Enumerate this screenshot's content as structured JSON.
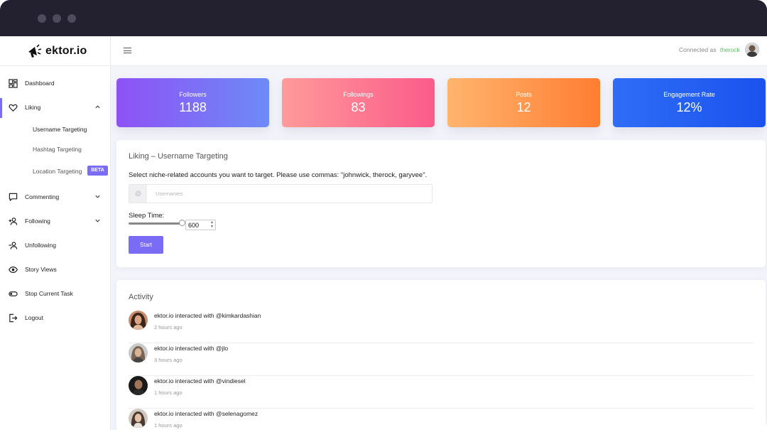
{
  "brand": {
    "name": "ektor.io"
  },
  "topbar": {
    "connected_label": "Connected as",
    "username": "therock"
  },
  "sidebar": {
    "items": [
      {
        "label": "Dashboard",
        "icon": "dashboard-icon"
      },
      {
        "label": "Liking",
        "icon": "heart-icon"
      },
      {
        "label": "Commenting",
        "icon": "comment-icon"
      },
      {
        "label": "Following",
        "icon": "user-plus-icon"
      },
      {
        "label": "Unfollowing",
        "icon": "user-minus-icon"
      },
      {
        "label": "Story Views",
        "icon": "eye-icon"
      },
      {
        "label": "Stop Current Task",
        "icon": "toggle-icon"
      },
      {
        "label": "Logout",
        "icon": "logout-icon"
      }
    ],
    "liking_sub": [
      {
        "label": "Username Targeting"
      },
      {
        "label": "Hashtag Targeting"
      },
      {
        "label": "Location Targeting",
        "badge": "BETA"
      }
    ]
  },
  "stats": [
    {
      "title": "Followers",
      "value": "1188"
    },
    {
      "title": "Followings",
      "value": "83"
    },
    {
      "title": "Posts",
      "value": "12"
    },
    {
      "title": "Engagement Rate",
      "value": "12%"
    }
  ],
  "targeting": {
    "title": "Liking – Username Targeting",
    "description": "Select niche-related accounts you want to target. Please use commas: \"johnwick, therock, garyvee\".",
    "input_addon": "@",
    "input_placeholder": "Usernames",
    "sleep_label": "Sleep Time:",
    "sleep_value": "600",
    "start_label": "Start"
  },
  "activity": {
    "title": "Activity",
    "items": [
      {
        "text": "ektor.io interacted with @kimkardashian",
        "time": "2 hours ago"
      },
      {
        "text": "ektor.io interacted with @jlo",
        "time": "3 hours ago"
      },
      {
        "text": "ektor.io interacted with @vindiesel",
        "time": "1 hours ago"
      },
      {
        "text": "ektor.io interacted with @selenagomez",
        "time": "1 hours ago"
      }
    ]
  },
  "colors": {
    "accent": "#7b6cf6",
    "connected_user": "#5dbb63",
    "followers_gradient": [
      "#8e52f5",
      "#6d8bf7"
    ],
    "followings_gradient": [
      "#ff9a9a",
      "#fb5b8a"
    ],
    "posts_gradient": [
      "#ffb46e",
      "#ff7e32"
    ],
    "engagement_gradient": [
      "#2f6df6",
      "#1a52ee"
    ]
  }
}
